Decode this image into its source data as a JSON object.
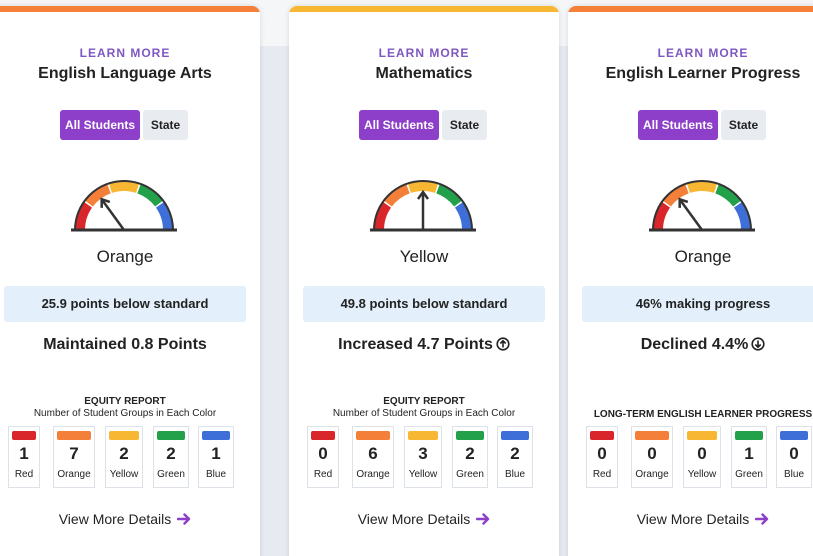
{
  "colors": {
    "red": "#d9262b",
    "orange": "#f47f39",
    "yellow": "#f7b732",
    "green": "#22a04a",
    "blue": "#3e6fd8",
    "purple": "#8d3fc9"
  },
  "cards": [
    {
      "accent": "#f47f39",
      "learn_more": "LEARN MORE",
      "title": "English Language Arts",
      "toggle": {
        "all_students": "All Students",
        "state": "State"
      },
      "gauge_level": "orange",
      "color_name": "Orange",
      "status": "25.9 points below standard",
      "change": "Maintained 0.8 Points",
      "change_icon": "none",
      "equity_title": "EQUITY REPORT",
      "equity_subtitle": "Number of Student Groups in Each Color",
      "groups": [
        {
          "count": "1",
          "label": "Red"
        },
        {
          "count": "7",
          "label": "Orange"
        },
        {
          "count": "2",
          "label": "Yellow"
        },
        {
          "count": "2",
          "label": "Green"
        },
        {
          "count": "1",
          "label": "Blue"
        }
      ],
      "details": "View More Details"
    },
    {
      "accent": "#f7b732",
      "learn_more": "LEARN MORE",
      "title": "Mathematics",
      "toggle": {
        "all_students": "All Students",
        "state": "State"
      },
      "gauge_level": "yellow",
      "color_name": "Yellow",
      "status": "49.8 points below standard",
      "change": "Increased 4.7 Points",
      "change_icon": "up-arrow-circle-icon",
      "equity_title": "EQUITY REPORT",
      "equity_subtitle": "Number of Student Groups in Each Color",
      "groups": [
        {
          "count": "0",
          "label": "Red"
        },
        {
          "count": "6",
          "label": "Orange"
        },
        {
          "count": "3",
          "label": "Yellow"
        },
        {
          "count": "2",
          "label": "Green"
        },
        {
          "count": "2",
          "label": "Blue"
        }
      ],
      "details": "View More Details"
    },
    {
      "accent": "#f47f39",
      "learn_more": "LEARN MORE",
      "title": "English Learner Progress",
      "toggle": {
        "all_students": "All Students",
        "state": "State"
      },
      "gauge_level": "orange",
      "color_name": "Orange",
      "status": "46% making progress",
      "change": "Declined 4.4%",
      "change_icon": "down-arrow-circle-icon",
      "equity_title": "LONG-TERM ENGLISH LEARNER PROGRESS",
      "equity_subtitle": "",
      "groups": [
        {
          "count": "0",
          "label": "Red"
        },
        {
          "count": "0",
          "label": "Orange"
        },
        {
          "count": "0",
          "label": "Yellow"
        },
        {
          "count": "1",
          "label": "Green"
        },
        {
          "count": "0",
          "label": "Blue"
        }
      ],
      "details": "View More Details"
    }
  ]
}
